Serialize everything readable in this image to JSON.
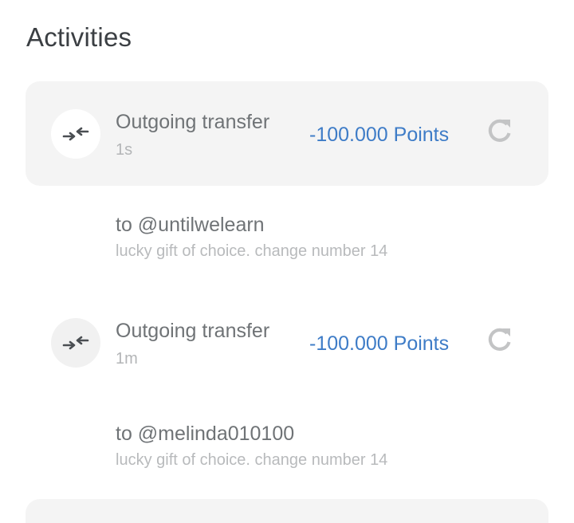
{
  "header": {
    "title": "Activities"
  },
  "colors": {
    "amount": "#3e7cc7",
    "card_background": "#f4f4f4",
    "title_text": "#3b3f43"
  },
  "activities": [
    {
      "icon": "transfer-arrows-icon",
      "title": "Outgoing transfer",
      "time": "1s",
      "amount": "-100.000 Points",
      "action_icon": "retry-icon",
      "recipient": "to @untilwelearn",
      "note": "lucky gift of choice. change number 14"
    },
    {
      "icon": "transfer-arrows-icon",
      "title": "Outgoing transfer",
      "time": "1m",
      "amount": "-100.000 Points",
      "action_icon": "retry-icon",
      "recipient": "to @melinda010100",
      "note": "lucky gift of choice. change number 14"
    }
  ]
}
